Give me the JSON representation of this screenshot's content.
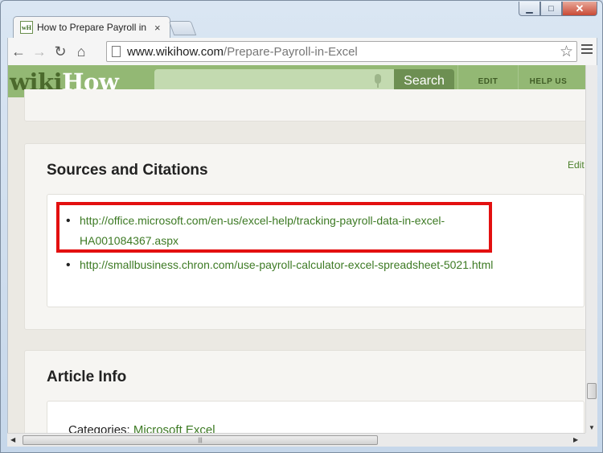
{
  "window": {
    "minimize": "▁",
    "maximize": "□",
    "close": "✕"
  },
  "tab": {
    "favicon": "wH",
    "title": "How to Prepare Payroll in",
    "close": "×"
  },
  "toolbar": {
    "back": "←",
    "forward": "→",
    "reload": "↻",
    "home": "⌂",
    "star": "☆"
  },
  "address": {
    "host": "www.wikihow.com",
    "path": "/Prepare-Payroll-in-Excel"
  },
  "header": {
    "logo_wiki": "wiki",
    "logo_how": "How",
    "search_placeholder": "",
    "search_button": "Search",
    "nav": [
      "EDIT",
      "HELP US"
    ]
  },
  "sources": {
    "title": "Sources and Citations",
    "edit": "Edit",
    "links": [
      {
        "line1": "http://office.microsoft.com/en-us/excel-help/tracking-payroll-data-in-excel-",
        "line2": "HA001084367.aspx"
      },
      {
        "line1": "http://smallbusiness.chron.com/use-payroll-calculator-excel-spreadsheet-5021.html"
      }
    ]
  },
  "article_info": {
    "title": "Article Info",
    "categories_label": "Categories:",
    "category": "Microsoft Excel"
  },
  "colors": {
    "brand_green": "#93b874",
    "link_green": "#3d7a24",
    "highlight_red": "#e31010"
  }
}
